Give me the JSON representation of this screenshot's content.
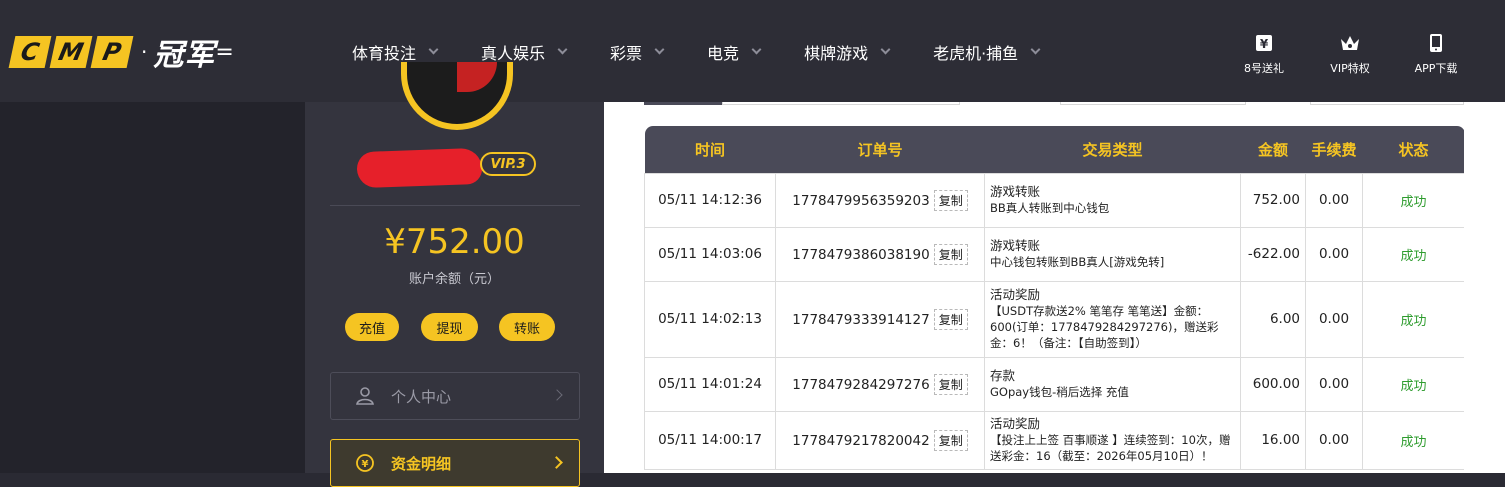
{
  "header": {
    "logo": {
      "letters": [
        "C",
        "M",
        "P"
      ],
      "dot": "·",
      "name": "冠军"
    },
    "nav": [
      {
        "label": "体育投注"
      },
      {
        "label": "真人娱乐"
      },
      {
        "label": "彩票"
      },
      {
        "label": "电竞"
      },
      {
        "label": "棋牌游戏"
      },
      {
        "label": "老虎机·捕鱼"
      }
    ],
    "actions": [
      {
        "label": "8号送礼",
        "icon": "gift-yen-icon"
      },
      {
        "label": "VIP特权",
        "icon": "crown-icon"
      },
      {
        "label": "APP下载",
        "icon": "mobile-icon"
      }
    ]
  },
  "sidebar": {
    "vip_badge": "VIP.3",
    "balance": "¥752.00",
    "balance_label": "账户余额（元）",
    "buttons": {
      "deposit": "充值",
      "withdraw": "提现",
      "transfer": "转账"
    },
    "menu": [
      {
        "label": "个人中心",
        "icon": "user-icon"
      },
      {
        "label": "资金明细",
        "icon": "yen-circle-icon",
        "active": true
      }
    ]
  },
  "table": {
    "headers": [
      "时间",
      "订单号",
      "交易类型",
      "金额",
      "手续费",
      "状态"
    ],
    "copy_label": "复制",
    "rows": [
      {
        "time": "05/11 14:12:36",
        "order": "1778479956359203",
        "type_title": "游戏转账",
        "type_desc": "BB真人转账到中心钱包",
        "amount": "752.00",
        "fee": "0.00",
        "status": "成功"
      },
      {
        "time": "05/11 14:03:06",
        "order": "1778479386038190",
        "type_title": "游戏转账",
        "type_desc": "中心钱包转账到BB真人[游戏免转]",
        "amount": "-622.00",
        "fee": "0.00",
        "status": "成功"
      },
      {
        "time": "05/11 14:02:13",
        "order": "1778479333914127",
        "type_title": "活动奖励",
        "type_desc": "【USDT存款送2% 笔笔存 笔笔送】金额：600(订单：1778479284297276)，赠送彩金：6！（备注：【自助签到】）",
        "amount": "6.00",
        "fee": "0.00",
        "status": "成功"
      },
      {
        "time": "05/11 14:01:24",
        "order": "1778479284297276",
        "type_title": "存款",
        "type_desc": "GOpay钱包-稍后选择 充值",
        "amount": "600.00",
        "fee": "0.00",
        "status": "成功"
      },
      {
        "time": "05/11 14:00:17",
        "order": "1778479217820042",
        "type_title": "活动奖励",
        "type_desc": "【投注上上签 百事顺遂 】连续签到：10次，赠送彩金：16（截至：2026年05月10日）！",
        "amount": "16.00",
        "fee": "0.00",
        "status": "成功"
      }
    ]
  },
  "colors": {
    "accent": "#f5c422",
    "header_bg": "#2d2d36",
    "sidebar_bg": "#34343e",
    "success": "#2e9c2e",
    "table_head": "#4a4a58"
  }
}
